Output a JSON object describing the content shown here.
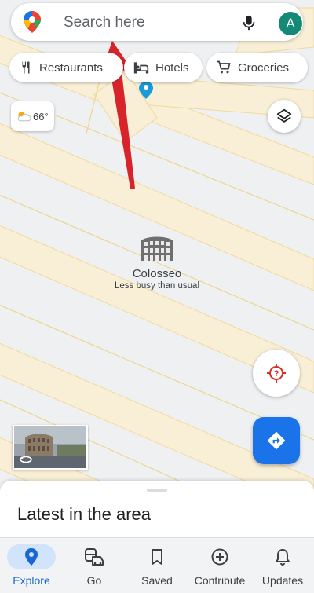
{
  "search": {
    "placeholder": "Search here",
    "avatar_letter": "A"
  },
  "chips": [
    {
      "label": "Restaurants",
      "icon": "fork-knife-icon"
    },
    {
      "label": "Hotels",
      "icon": "bed-icon"
    },
    {
      "label": "Groceries",
      "icon": "cart-icon"
    }
  ],
  "weather": {
    "temp": "66°",
    "icon": "partly-cloudy-icon"
  },
  "poi": {
    "name": "Colosseo",
    "subtitle": "Less busy than usual",
    "icon": "colosseum-icon"
  },
  "sheet": {
    "title": "Latest in the area"
  },
  "nav": [
    {
      "label": "Explore",
      "icon": "location-pin-icon",
      "active": true
    },
    {
      "label": "Go",
      "icon": "commute-icon",
      "active": false
    },
    {
      "label": "Saved",
      "icon": "bookmark-icon",
      "active": false
    },
    {
      "label": "Contribute",
      "icon": "add-circle-icon",
      "active": false
    },
    {
      "label": "Updates",
      "icon": "bell-icon",
      "active": false
    }
  ],
  "colors": {
    "accent": "#1a73e8",
    "arrow": "#d9232a",
    "avatar": "#128a76",
    "map_road": "#f6e7bf",
    "map_block": "#eef0f2"
  }
}
